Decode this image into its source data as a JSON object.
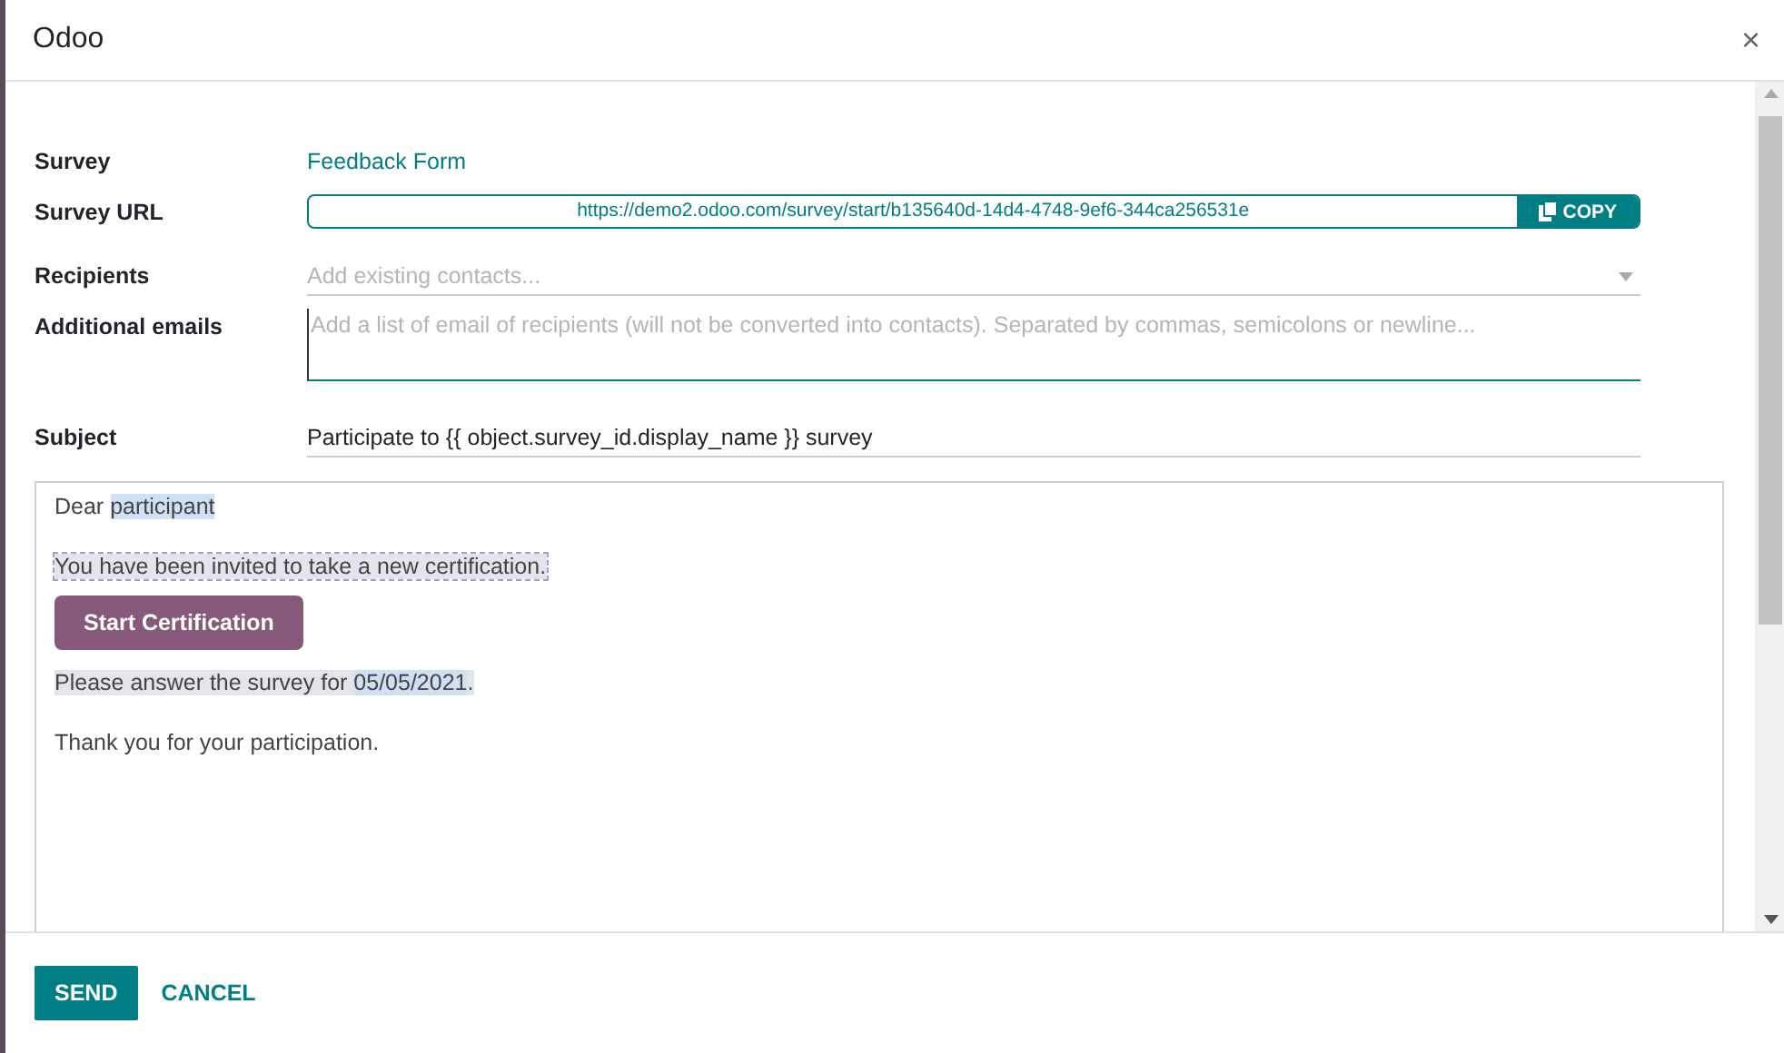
{
  "dialog": {
    "title": "Odoo",
    "close": "×"
  },
  "fields": [
    {
      "kind": "link",
      "label": "Survey",
      "value": "Feedback Form"
    },
    {
      "kind": "url",
      "label": "Survey URL",
      "value": "https://demo2.odoo.com/survey/start/b135640d-14d4-4748-9ef6-344ca256531e",
      "button": "COPY"
    },
    {
      "kind": "select",
      "label": "Recipients",
      "placeholder": "Add existing contacts..."
    },
    {
      "kind": "textarea",
      "label": "Additional emails",
      "placeholder": "Add a list of email of recipients (will not be converted into contacts). Separated by commas, semicolons or newline..."
    },
    {
      "kind": "text",
      "label": "Subject",
      "value": "Participate to {{ object.survey_id.display_name }} survey"
    }
  ],
  "body": [
    {
      "kind": "text",
      "selected": false,
      "parts": [
        {
          "text": "Dear ",
          "dynamic": false
        },
        {
          "text": "participant",
          "dynamic": true
        }
      ]
    },
    {
      "kind": "text",
      "selected": true,
      "parts": [
        {
          "text": "You have been invited to take a new certification.",
          "dynamic": false
        }
      ]
    },
    {
      "kind": "button",
      "label": "Start Certification"
    },
    {
      "kind": "text",
      "selected": true,
      "parts": [
        {
          "text": "Please answer the survey for ",
          "dynamic": false
        },
        {
          "text": "05/05/2021",
          "dynamic": true
        },
        {
          "text": ".",
          "dynamic": false
        }
      ]
    },
    {
      "kind": "text",
      "selected": false,
      "parts": [
        {
          "text": "Thank you for your participation.",
          "dynamic": false
        }
      ]
    }
  ],
  "buttons": [
    {
      "label": "SEND",
      "primary": true
    },
    {
      "label": "CANCEL",
      "primary": false
    }
  ]
}
